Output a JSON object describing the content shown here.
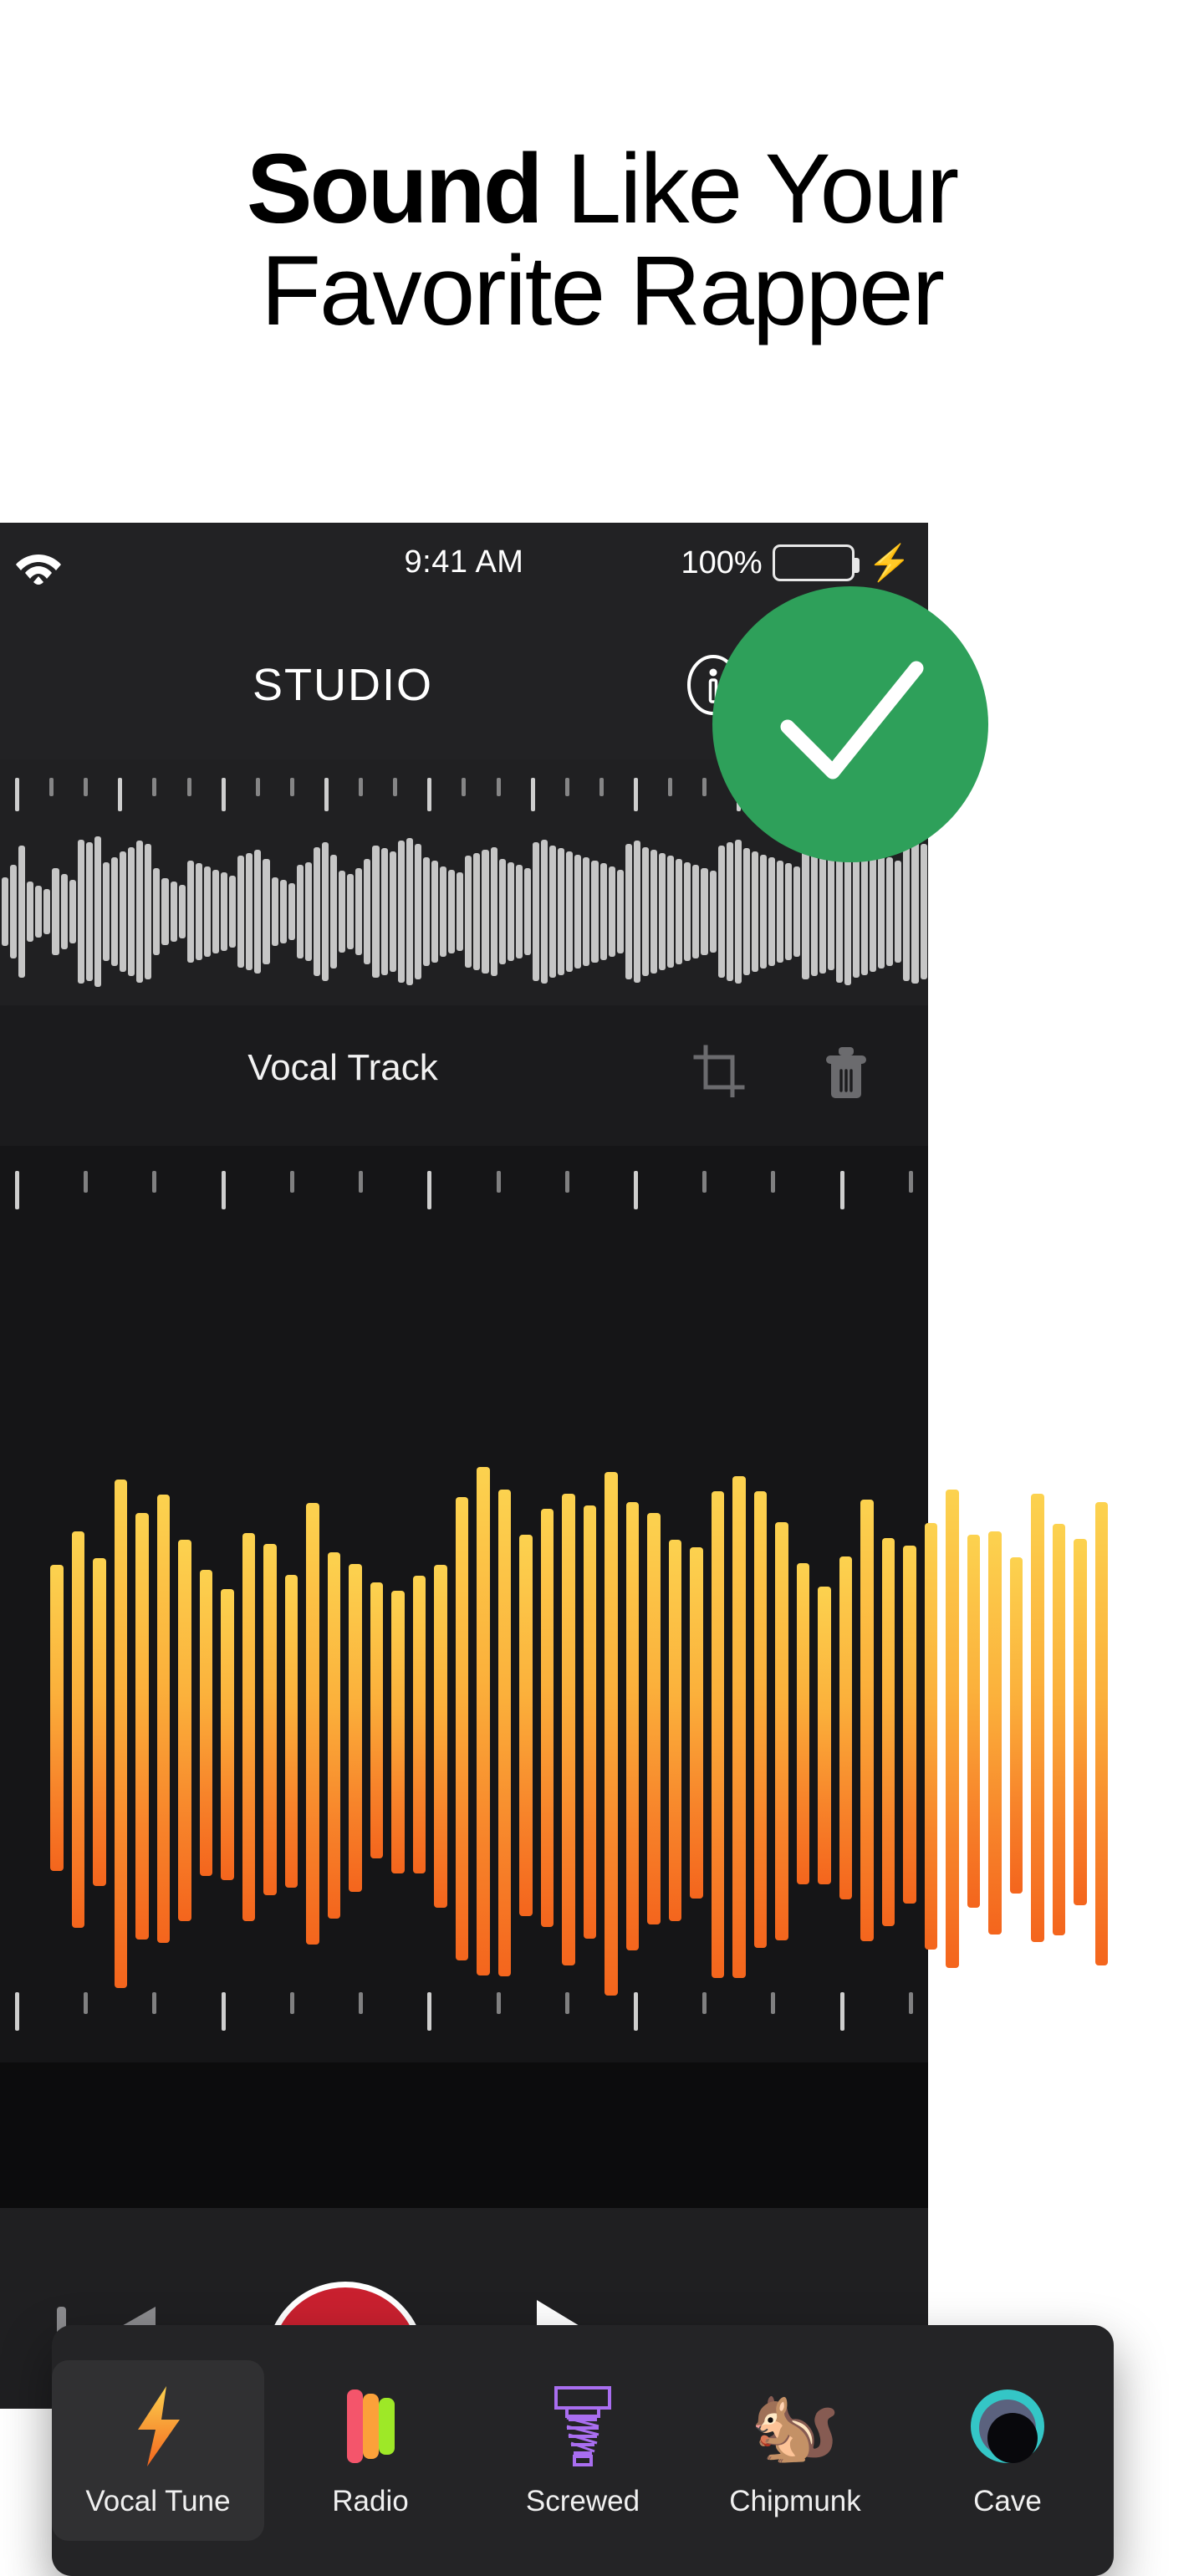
{
  "headline": {
    "line1_bold": "Sound",
    "line1_rest": " Like Your",
    "line2": "Favorite Rapper"
  },
  "status_bar": {
    "wifi_icon": "wifi-icon",
    "time": "9:41 AM",
    "battery_percent": "100%",
    "battery_icon": "battery-full-icon",
    "charging_icon": "lightning-bolt-icon",
    "battery_color": "#3ad14f"
  },
  "nav_bar": {
    "title": "STUDIO",
    "info_icon": "info-circle-icon",
    "notes_icon": "note-edit-icon"
  },
  "overview_track": {
    "waveform_color": "#c6c6c6",
    "bar_heights": [
      46,
      62,
      88,
      40,
      34,
      30,
      58,
      50,
      42,
      96,
      92,
      100,
      66,
      72,
      80,
      86,
      94,
      90,
      58,
      44,
      40,
      36,
      68,
      64,
      60,
      56,
      52,
      48,
      74,
      78,
      82,
      70,
      46,
      42,
      38,
      62,
      66,
      86,
      92,
      76,
      54,
      50,
      58,
      70,
      88,
      84,
      80,
      94,
      98,
      90,
      72,
      68,
      60,
      56,
      52,
      74,
      78,
      82,
      86,
      70,
      66,
      62,
      58,
      92,
      96,
      88,
      84,
      80,
      76,
      72,
      68,
      64,
      60,
      56,
      90,
      94,
      86,
      82,
      78,
      74,
      70,
      66,
      62,
      58,
      54,
      88,
      92,
      96,
      84,
      80,
      76,
      72,
      68,
      64,
      60,
      90,
      86,
      82,
      78,
      94,
      98,
      88,
      84,
      80,
      76,
      72,
      68,
      92,
      96,
      90
    ]
  },
  "track_header": {
    "title": "Vocal Track",
    "crop_icon": "crop-icon",
    "delete_icon": "trash-icon"
  },
  "main_waveform": {
    "gradient_top": "#fcd24f",
    "gradient_bottom": "#f4651d",
    "bar_heights": [
      30,
      54,
      36,
      84,
      62,
      68,
      50,
      30,
      26,
      52,
      42,
      32,
      66,
      46,
      36,
      22,
      24,
      28,
      40,
      72,
      84,
      78,
      50,
      60,
      74,
      64,
      88,
      68,
      58,
      50,
      42,
      78,
      82,
      70,
      60,
      34,
      28,
      40,
      66,
      52,
      44,
      62,
      76,
      48,
      56,
      38,
      68,
      58,
      46,
      72
    ]
  },
  "effects": {
    "items": [
      {
        "label": "Vocal Tune",
        "icon": "lightning-bolt-icon",
        "selected": true
      },
      {
        "label": "Radio",
        "icon": "radio-bars-icon",
        "selected": false
      },
      {
        "label": "Screwed",
        "icon": "screw-bolt-icon",
        "selected": false
      },
      {
        "label": "Chipmunk",
        "icon": "squirrel-icon",
        "selected": false
      },
      {
        "label": "Cave",
        "icon": "cave-echo-icon",
        "selected": false
      }
    ],
    "chipmunk_glyph": "🐿️",
    "radio_colors": [
      "#f4556b",
      "#fba13a",
      "#9ee827"
    ],
    "screw_color": "#a96ef0",
    "cave_colors": [
      "#34c6c6",
      "#5b627e",
      "#08080c"
    ]
  },
  "transport": {
    "rewind_icon": "rewind-icon",
    "record_icon": "record-button",
    "play_icon": "play-icon",
    "done_icon": "checkmark-button",
    "record_color": "#c9202f",
    "done_color": "#2ea05a"
  }
}
